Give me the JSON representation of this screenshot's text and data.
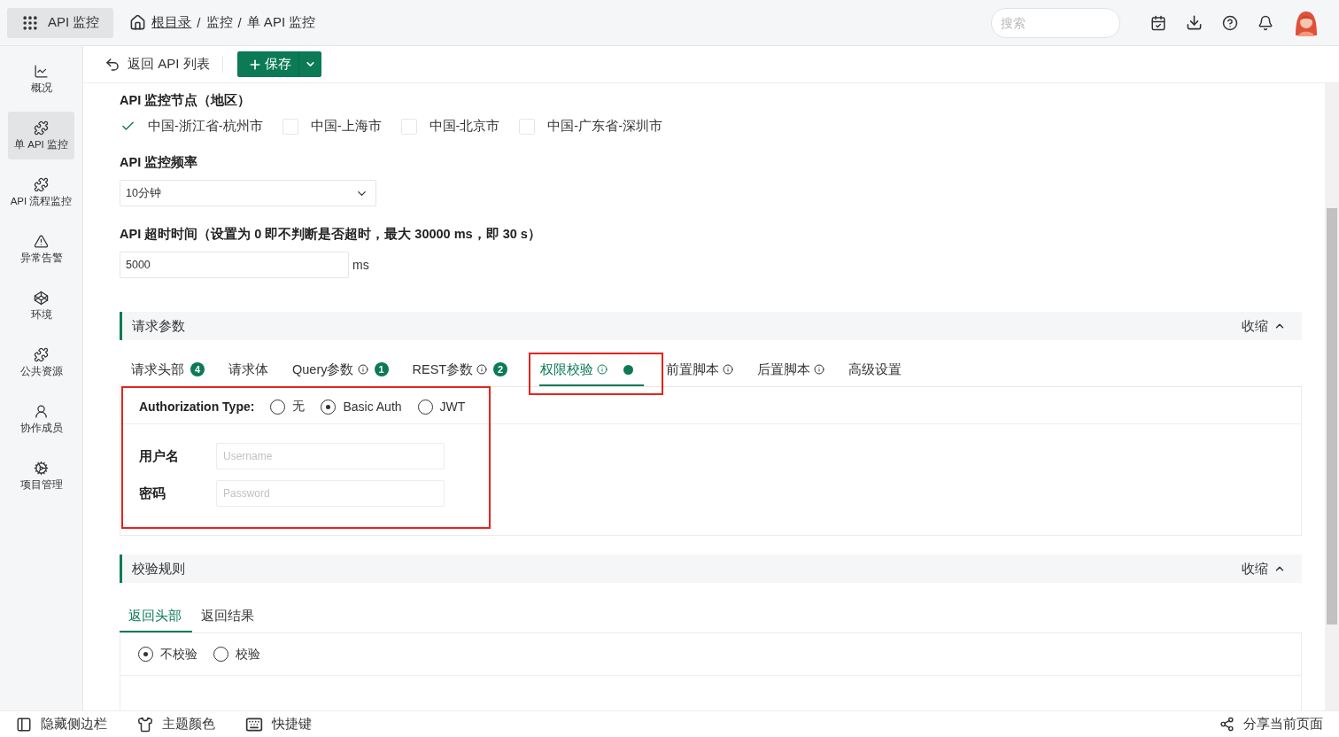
{
  "app_switcher": {
    "label": "API 监控"
  },
  "breadcrumb": {
    "separator": "/",
    "items": [
      "根目录",
      "监控",
      "单 API 监控"
    ]
  },
  "search": {
    "placeholder": "搜索"
  },
  "sidebar": {
    "items": [
      {
        "kind": "chart",
        "label": "概况",
        "selected": false
      },
      {
        "kind": "puzzle",
        "label": "单 API 监控",
        "selected": true
      },
      {
        "kind": "puzzle",
        "label": "API 流程监控",
        "selected": false
      },
      {
        "kind": "alert",
        "label": "异常告警",
        "selected": false
      },
      {
        "kind": "cube",
        "label": "环境",
        "selected": false
      },
      {
        "kind": "puzzle",
        "label": "公共资源",
        "selected": false
      },
      {
        "kind": "user",
        "label": "协作成员",
        "selected": false
      },
      {
        "kind": "gear",
        "label": "项目管理",
        "selected": false
      }
    ]
  },
  "toolbar": {
    "back": "返回 API 列表",
    "save": "保存"
  },
  "nodes": {
    "label": "API 监控节点（地区）",
    "options": [
      {
        "label": "中国-浙江省-杭州市",
        "checked": true
      },
      {
        "label": "中国-上海市",
        "checked": false
      },
      {
        "label": "中国-北京市",
        "checked": false
      },
      {
        "label": "中国-广东省-深圳市",
        "checked": false
      }
    ]
  },
  "frequency": {
    "label": "API 监控频率",
    "value": "10分钟"
  },
  "timeout": {
    "label": "API 超时时间（设置为 0 即不判断是否超时，最大 30000 ms，即 30 s）",
    "value": "5000",
    "unit": "ms"
  },
  "request_section": {
    "title": "请求参数",
    "collapse": "收缩",
    "tabs": [
      {
        "label": "请求头部",
        "badge": "4",
        "info": false,
        "dot": false,
        "selected": false,
        "highlighted": false
      },
      {
        "label": "请求体",
        "info": false,
        "dot": false,
        "selected": false,
        "highlighted": false
      },
      {
        "label": "Query参数",
        "badge": "1",
        "info": true,
        "dot": false,
        "selected": false,
        "highlighted": false
      },
      {
        "label": "REST参数",
        "badge": "2",
        "info": true,
        "dot": false,
        "selected": false,
        "highlighted": false
      },
      {
        "label": "权限校验",
        "info": true,
        "dot": true,
        "selected": true,
        "highlighted": true
      },
      {
        "label": "前置脚本",
        "info": true,
        "dot": false,
        "selected": false,
        "highlighted": false
      },
      {
        "label": "后置脚本",
        "info": true,
        "dot": false,
        "selected": false,
        "highlighted": false
      },
      {
        "label": "高级设置",
        "info": false,
        "dot": false,
        "selected": false,
        "highlighted": false
      }
    ]
  },
  "auth": {
    "label": "Authorization Type:",
    "highlighted": true,
    "options": [
      {
        "label": "无",
        "selected": false
      },
      {
        "label": "Basic Auth",
        "selected": true
      },
      {
        "label": "JWT",
        "selected": false
      }
    ],
    "fields": [
      {
        "label": "用户名",
        "placeholder": "Username"
      },
      {
        "label": "密码",
        "placeholder": "Password"
      }
    ]
  },
  "validation_section": {
    "title": "校验规则",
    "collapse": "收缩",
    "tabs": [
      {
        "label": "返回头部",
        "selected": true
      },
      {
        "label": "返回结果",
        "selected": false
      }
    ],
    "options": [
      {
        "label": "不校验",
        "selected": true
      },
      {
        "label": "校验",
        "selected": false
      }
    ]
  },
  "footer": {
    "items": [
      {
        "kind": "sidebar",
        "label": "隐藏侧边栏"
      },
      {
        "kind": "theme",
        "label": "主题颜色"
      },
      {
        "kind": "keyboard",
        "label": "快捷键"
      }
    ],
    "share": "分享当前页面"
  }
}
